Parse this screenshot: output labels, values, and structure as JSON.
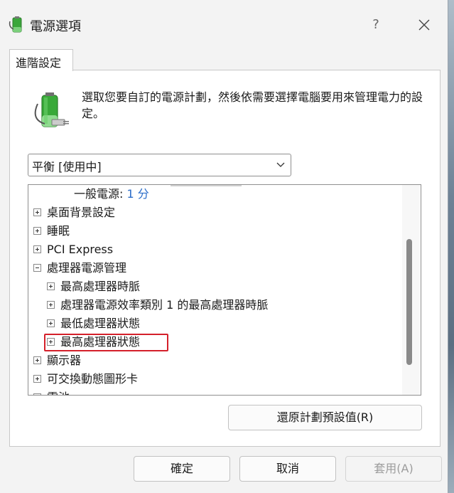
{
  "window": {
    "title": "電源選項",
    "help_label": "?",
    "close_label": "✕"
  },
  "tab": {
    "label": "進階設定"
  },
  "description": "選取您要自訂的電源計劃，然後依需要選擇電腦要用來管理電力的設定。",
  "plan_select": {
    "value": "平衡 [使用中]"
  },
  "tree": {
    "partial_item": {
      "label": "一般電源:",
      "value": "1 分"
    },
    "items": [
      {
        "label": "桌面背景設定"
      },
      {
        "label": "睡眠"
      },
      {
        "label": "PCI Express"
      },
      {
        "label": "處理器電源管理"
      },
      {
        "label": "最高處理器時脈"
      },
      {
        "label": "處理器電源效率類別 1 的最高處理器時脈"
      },
      {
        "label": "最低處理器狀態"
      },
      {
        "label": "最高處理器狀態"
      },
      {
        "label": "顯示器"
      },
      {
        "label": "可交換動態圖形卡"
      },
      {
        "label": "電池"
      }
    ]
  },
  "buttons": {
    "restore": "還原計劃預設值(R)",
    "ok": "確定",
    "cancel": "取消",
    "apply": "套用(A)"
  },
  "colors": {
    "highlight": "#d4202a",
    "value_link": "#2a6cc9"
  }
}
